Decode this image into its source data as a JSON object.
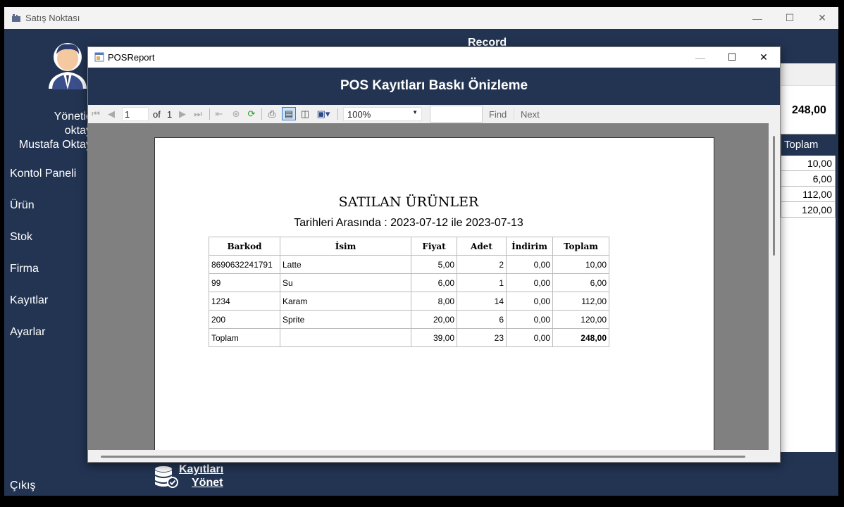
{
  "main_window": {
    "title": "Satış Noktası"
  },
  "sidebar": {
    "user_lines": [
      "Yönetic",
      "oktay",
      "Mustafa Oktay"
    ],
    "menu": [
      "Kontol Paneli",
      "Ürün",
      "Stok",
      "Firma",
      "Kayıtlar",
      "Ayarlar"
    ],
    "exit": "Çıkış"
  },
  "background": {
    "record_label": "Record",
    "total": "248,00",
    "table_header": "Toplam",
    "table_values": [
      "10,00",
      "6,00",
      "112,00",
      "120,00"
    ],
    "manage_link": [
      "Kayıtları",
      "Yönet"
    ]
  },
  "report_window": {
    "title": "POSReport",
    "header": "POS Kayıtları Baskı Önizleme",
    "toolbar": {
      "page": "1",
      "of_label": "of",
      "total_pages": "1",
      "zoom": "100%",
      "find_placeholder": "",
      "find_label": "Find",
      "next_label": "Next"
    }
  },
  "report": {
    "title": "SATILAN ÜRÜNLER",
    "subtitle": "Tarihleri Arasında : 2023-07-12 ile 2023-07-13",
    "columns": [
      "Barkod",
      "İsim",
      "Fiyat",
      "Adet",
      "İndirim",
      "Toplam"
    ],
    "rows": [
      [
        "8690632241791",
        "Latte",
        "5,00",
        "2",
        "0,00",
        "10,00"
      ],
      [
        "99",
        "Su",
        "6,00",
        "1",
        "0,00",
        "6,00"
      ],
      [
        "1234",
        "Karam",
        "8,00",
        "14",
        "0,00",
        "112,00"
      ],
      [
        "200",
        "Sprite",
        "20,00",
        "6",
        "0,00",
        "120,00"
      ]
    ],
    "total_row": [
      "Toplam",
      "",
      "39,00",
      "23",
      "0,00",
      "248,00"
    ]
  }
}
